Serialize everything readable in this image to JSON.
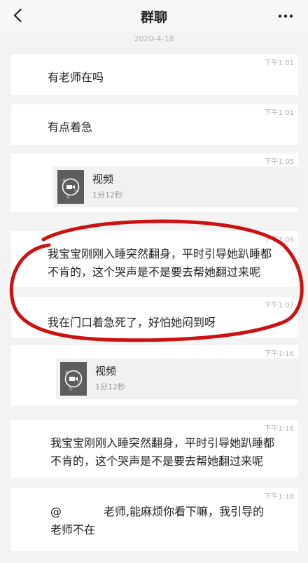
{
  "header": {
    "title": "群聊"
  },
  "date_separator": "2020-4-18",
  "messages": [
    {
      "time": "下午1:01",
      "text": "有老师在吗"
    },
    {
      "time": "下午1:01",
      "text": "有点着急"
    },
    {
      "time": "下午1:05",
      "video": {
        "title": "视频",
        "duration": "1分12秒"
      }
    },
    {
      "time": "下午1:06",
      "lines": [
        "我宝宝刚刚入睡突然翻身，平时引导她趴睡都",
        "不肯的，这个哭声是不是要去帮她翻过来呢"
      ]
    },
    {
      "time": "下午1:07",
      "text": "我在门口着急死了，好怕她闷到呀"
    },
    {
      "time": "下午1:16",
      "video": {
        "title": "视频",
        "duration": "1分12秒"
      }
    },
    {
      "time": "下午1:16",
      "lines": [
        "我宝宝刚刚入睡突然翻身，平时引导她趴睡都",
        "不肯的，这个哭声是不是要去帮她翻过来呢"
      ]
    },
    {
      "time": "下午1:18",
      "mention": "@",
      "lines": [
        "老师,能麻烦你看下嘛，我引导的",
        "老师不在"
      ]
    }
  ],
  "highlight_color": "#cc1111",
  "icons": {
    "back": "chevron-left-icon",
    "more": "more-dots-icon",
    "video": "video-camera-icon"
  }
}
